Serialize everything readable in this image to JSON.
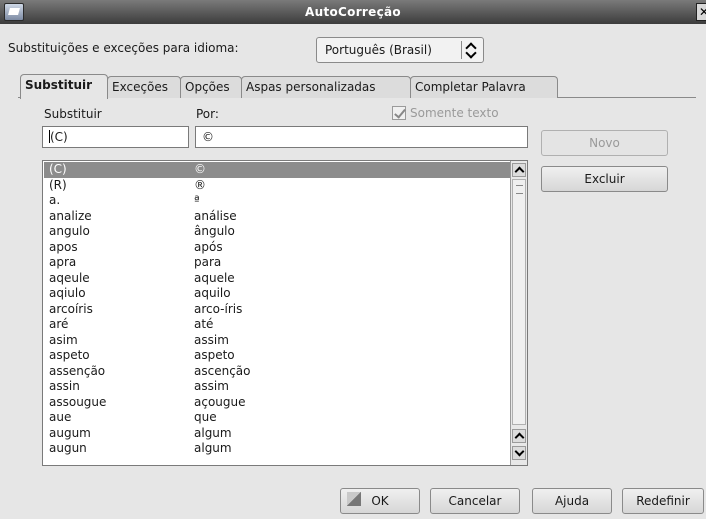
{
  "window": {
    "title": "AutoCorreção",
    "close_glyph": "✕"
  },
  "language_row": {
    "label": "Substituições e exceções para idioma:",
    "selected_language": "Português (Brasil)"
  },
  "tabs": [
    {
      "label": "Substituir",
      "active": true
    },
    {
      "label": "Exceções"
    },
    {
      "label": "Opções"
    },
    {
      "label": "Aspas personalizadas"
    },
    {
      "label": "Completar Palavra"
    }
  ],
  "replace_panel": {
    "replace_label": "Substituir",
    "with_label": "Por:",
    "text_only_label": "Somente texto",
    "text_only_checked": true,
    "replace_value": "(C)",
    "with_value": "©",
    "new_button": "Novo",
    "delete_button": "Excluir"
  },
  "entries": [
    {
      "from": "(C)",
      "to": "©"
    },
    {
      "from": "(R)",
      "to": "®"
    },
    {
      "from": "a.",
      "to": "ª"
    },
    {
      "from": "analize",
      "to": "análise"
    },
    {
      "from": "angulo",
      "to": "ângulo"
    },
    {
      "from": "apos",
      "to": "após"
    },
    {
      "from": "apra",
      "to": "para"
    },
    {
      "from": "aqeule",
      "to": "aquele"
    },
    {
      "from": "aqiulo",
      "to": "aquilo"
    },
    {
      "from": "arcoíris",
      "to": "arco-íris"
    },
    {
      "from": "aré",
      "to": "até"
    },
    {
      "from": "asim",
      "to": "assim"
    },
    {
      "from": "aspeto",
      "to": "aspeto"
    },
    {
      "from": "assenção",
      "to": "ascenção"
    },
    {
      "from": "assin",
      "to": "assim"
    },
    {
      "from": "assougue",
      "to": "açougue"
    },
    {
      "from": "aue",
      "to": "que"
    },
    {
      "from": "augum",
      "to": "algum"
    },
    {
      "from": "augun",
      "to": "algum"
    }
  ],
  "footer": {
    "ok": "OK",
    "cancel": "Cancelar",
    "help": "Ajuda",
    "reset": "Redefinir"
  }
}
